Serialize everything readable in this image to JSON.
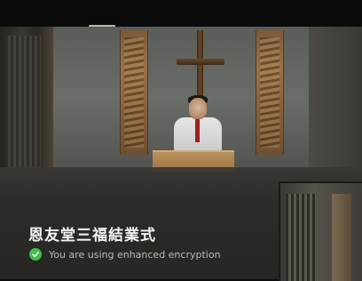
{
  "meeting": {
    "title": "恩友堂三福結業式",
    "encryption_text": "You are using enhanced encryption"
  },
  "icons": {
    "encryption": "check-shield-icon"
  },
  "colors": {
    "encryption_green": "#3fbf4a",
    "title_text": "#f4f4f2",
    "panel_bg": "#2d2b27"
  }
}
